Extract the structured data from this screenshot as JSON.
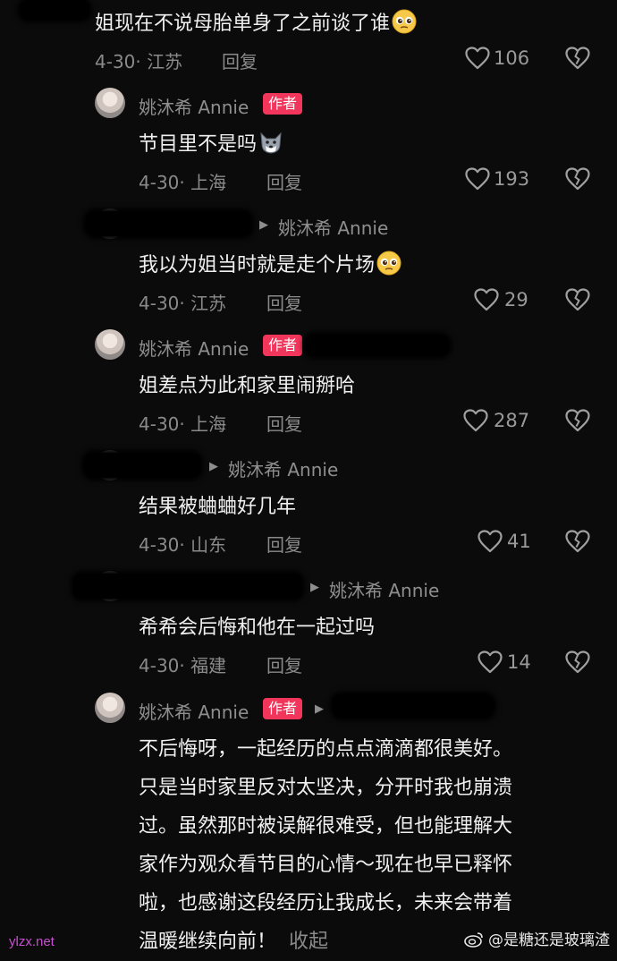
{
  "top_comment": {
    "text": "姐现在不说母胎单身了之前谈了谁",
    "date_location": "4-30· 江苏",
    "reply_label": "回复",
    "likes": "106"
  },
  "replies": [
    {
      "author": "姚沐希 Annie",
      "badge": "作者",
      "text": "节目里不是吗",
      "date_location": "4-30· 上海",
      "reply_label": "回复",
      "likes": "193"
    },
    {
      "reply_to": "姚沐希 Annie",
      "text": "我以为姐当时就是走个片场",
      "date_location": "4-30· 江苏",
      "reply_label": "回复",
      "likes": "29"
    },
    {
      "author": "姚沐希 Annie",
      "badge": "作者",
      "text": "姐差点为此和家里闹掰哈",
      "date_location": "4-30· 上海",
      "reply_label": "回复",
      "likes": "287"
    },
    {
      "reply_to": "姚沐希 Annie",
      "text": "结果被蛐蛐好几年",
      "date_location": "4-30· 山东",
      "reply_label": "回复",
      "likes": "41"
    },
    {
      "reply_to": "姚沐希 Annie",
      "text": "希希会后悔和他在一起过吗",
      "date_location": "4-30· 福建",
      "reply_label": "回复",
      "likes": "14"
    }
  ],
  "last_reply": {
    "author": "姚沐希 Annie",
    "badge": "作者",
    "lines": [
      "不后悔呀，一起经历的点点滴滴都很美好。",
      "只是当时家里反对太坚决，分开时我也崩溃",
      "过。虽然那时被误解很难受，但也能理解大",
      "家作为观众看节目的心情～现在也早已释怀",
      "啦，也感谢这段经历让我成长，未来会带着",
      "温暖继续向前！"
    ],
    "collapse_label": "收起"
  },
  "watermarks": {
    "left": "ylzx.net",
    "right": "@是糖还是玻璃渣"
  },
  "colors": {
    "background": "#0b0b0b",
    "author_badge": "#f2355a",
    "secondary_text": "#8a8a8a"
  }
}
